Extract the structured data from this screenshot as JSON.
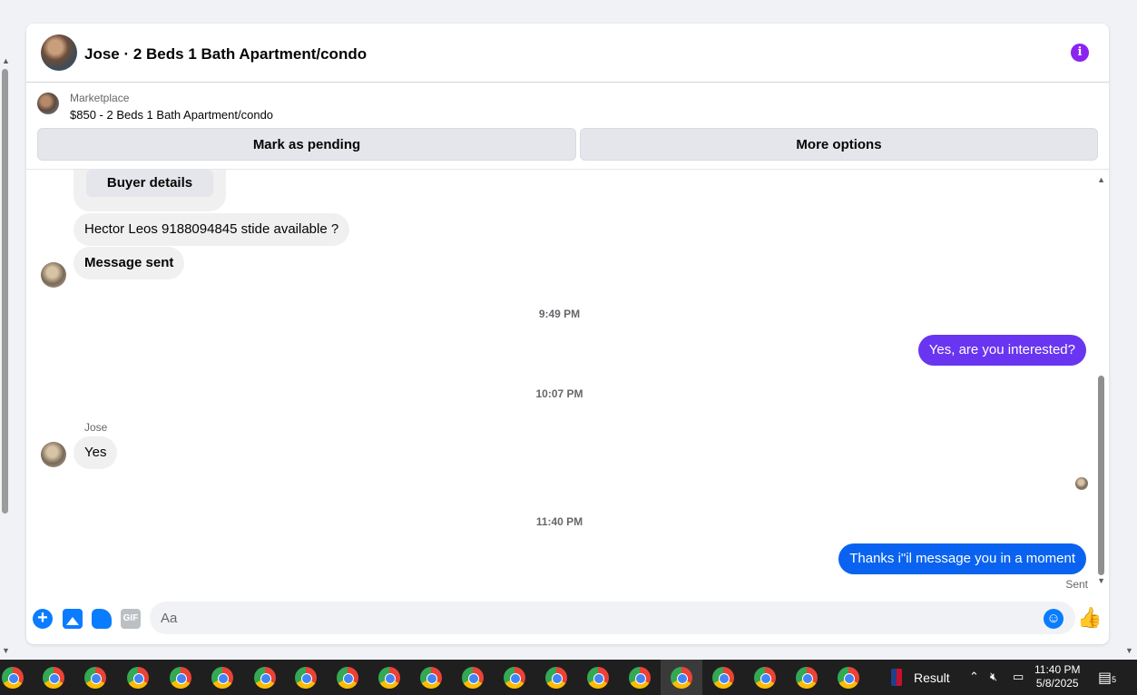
{
  "conversation": {
    "title": "Jose · 2 Beds 1 Bath Apartment/condo"
  },
  "listing": {
    "source": "Marketplace",
    "item": "$850 - 2 Beds 1 Bath Apartment/condo",
    "mark_pending_label": "Mark as pending",
    "more_options_label": "More options"
  },
  "messages": {
    "buyer_details_label": "Buyer details",
    "incoming_1": "Hector Leos 9188094845 stide available ?",
    "incoming_2": "Message sent",
    "time_1": "9:49 PM",
    "outgoing_1": "Yes, are you interested?",
    "time_2": "10:07 PM",
    "sender_name": "Jose",
    "incoming_3": "Yes",
    "time_3": "11:40 PM",
    "outgoing_2": "Thanks i\"il message you in a moment",
    "status": "Sent"
  },
  "composer": {
    "placeholder": "Aa",
    "gif_label": "GIF"
  },
  "colors": {
    "outgoing_purple": "#6a35f0",
    "outgoing_blue": "#0a63f0",
    "accent": "#0a7cff",
    "info": "#8a24f0"
  },
  "taskbar": {
    "result_label": "Result",
    "time": "11:40 PM",
    "date": "5/8/2025",
    "notification_count": "5"
  }
}
